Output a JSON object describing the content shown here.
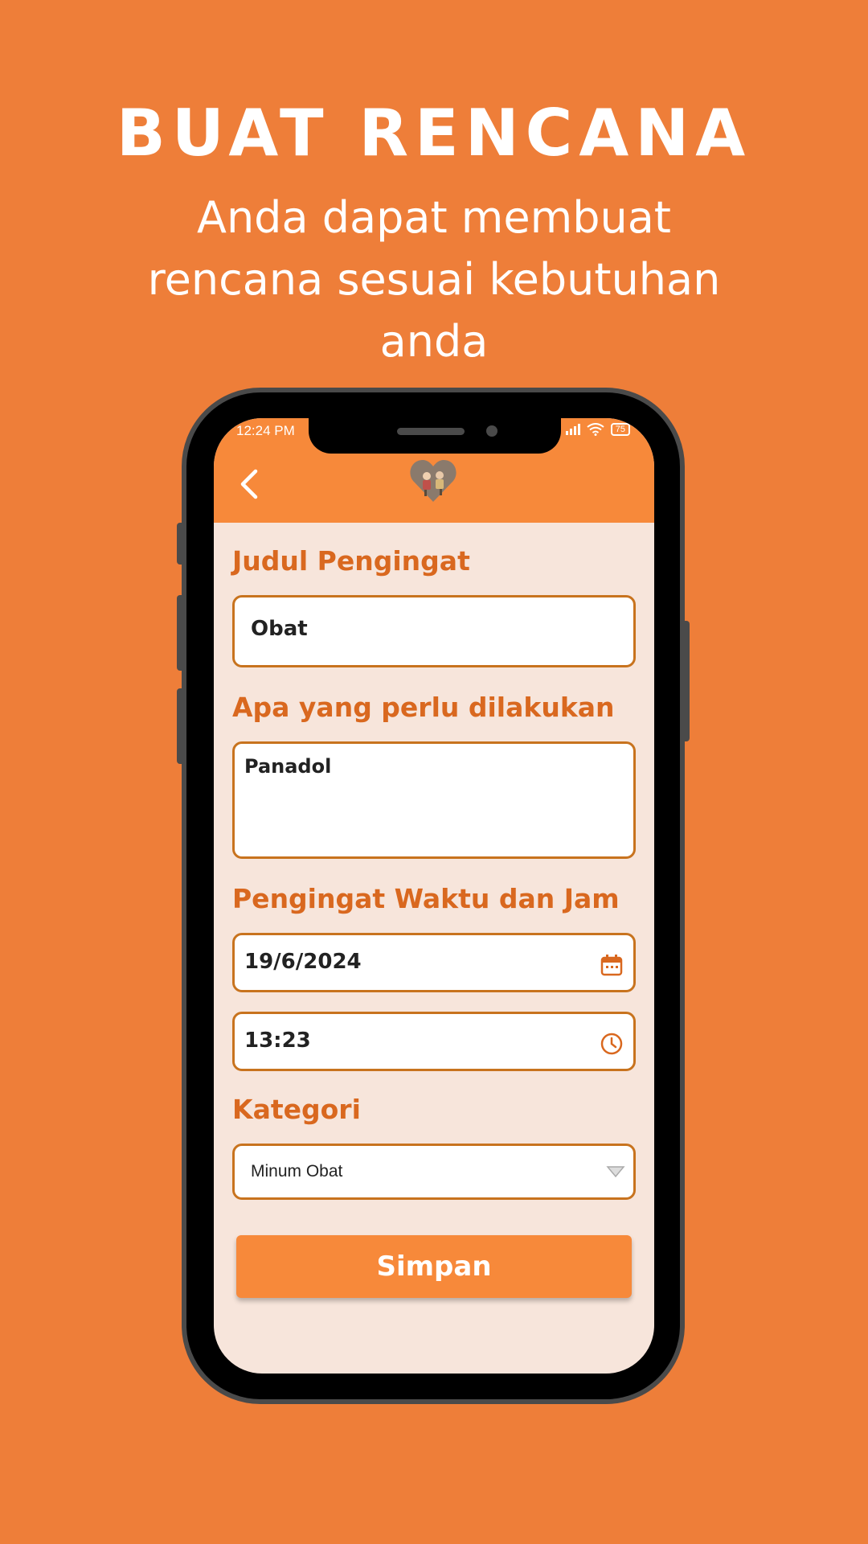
{
  "promo": {
    "title": "BUAT RENCANA",
    "subtitle": "Anda dapat membuat rencana sesuai kebutuhan anda"
  },
  "status_bar": {
    "time": "12:24 PM",
    "battery": "75"
  },
  "form": {
    "title_label": "Judul Pengingat",
    "title_value": "Obat",
    "task_label": "Apa yang perlu dilakukan",
    "task_value": "Panadol",
    "datetime_label": "Pengingat Waktu dan Jam",
    "date_value": "19/6/2024",
    "time_value": "13:23",
    "category_label": "Kategori",
    "category_value": "Minum Obat",
    "save_label": "Simpan"
  },
  "icons": {
    "back": "chevron-left-icon",
    "logo": "heart-logo",
    "date": "calendar-icon",
    "time": "clock-icon",
    "select": "triangle-down-icon"
  },
  "colors": {
    "background": "#EE7E39",
    "appbar": "#F7893A",
    "screen_bg": "#F7E5DB",
    "label": "#D9681F",
    "border": "#C8731E"
  }
}
